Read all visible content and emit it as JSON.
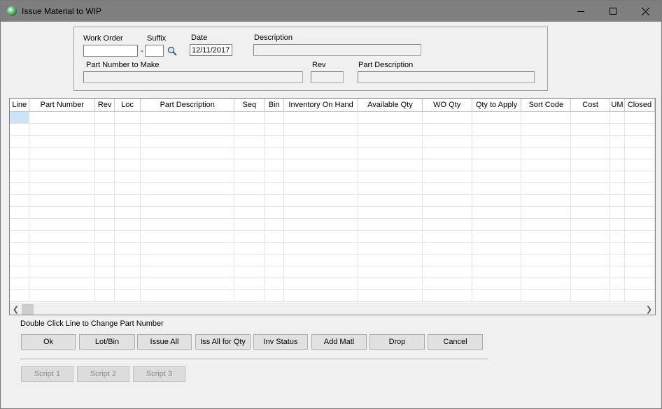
{
  "window": {
    "title": "Issue Material to WIP"
  },
  "header": {
    "work_order_label": "Work Order",
    "work_order_value": "",
    "suffix_label": "Suffix",
    "suffix_value": "",
    "dash": "-",
    "date_label": "Date",
    "date_value": "12/11/2017",
    "description_label": "Description",
    "description_value": "",
    "part_number_label": "Part Number to Make",
    "part_number_value": "",
    "rev_label": "Rev",
    "rev_value": "",
    "part_description_label": "Part Description",
    "part_description_value": ""
  },
  "grid": {
    "columns": [
      "Line",
      "Part Number",
      "Rev",
      "Loc",
      "Part Description",
      "Seq",
      "Bin",
      "Inventory On Hand",
      "Available Qty",
      "WO Qty",
      "Qty to Apply",
      "Sort Code",
      "Cost",
      "UM",
      "Closed"
    ],
    "rows": [],
    "scroll_left_icon": "chevron-left-icon",
    "scroll_right_icon": "chevron-right-icon"
  },
  "hint": "Double Click Line to Change Part Number",
  "buttons": {
    "ok": "Ok",
    "lot_bin": "Lot/Bin",
    "issue_all": "Issue All",
    "iss_all_for_qty": "Iss All for Qty",
    "inv_status": "Inv Status",
    "add_matl": "Add Matl",
    "drop": "Drop",
    "cancel": "Cancel",
    "script1": "Script 1",
    "script2": "Script 2",
    "script3": "Script 3"
  },
  "colors": {
    "titlebar": "#7f7f7f",
    "selected_cell": "#cce4f7",
    "window_bg": "#f0f0f0"
  }
}
